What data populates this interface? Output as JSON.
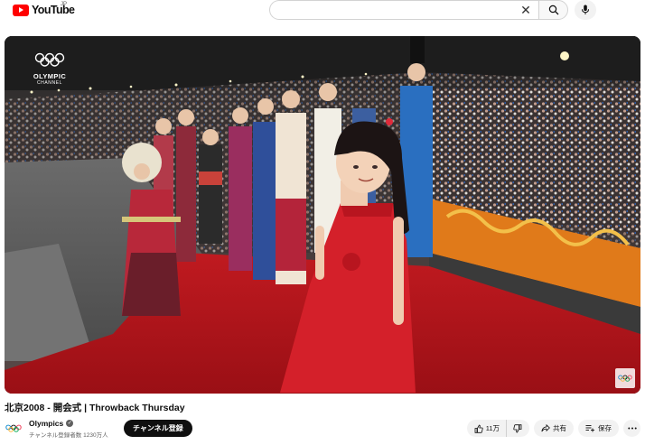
{
  "header": {
    "logo_text": "YouTube",
    "logo_region": "JP",
    "search_value": "",
    "search_icon": "search-icon",
    "clear_icon": "close-icon",
    "mic_icon": "microphone-icon"
  },
  "video": {
    "watermark_line1": "OLYMPIC",
    "watermark_line2": "CHANNEL",
    "colors": {
      "carpet": "#b0131a",
      "dress": "#d4202a",
      "stage": "#5b5b5b",
      "banner": "#e07a1a"
    }
  },
  "title": "北京2008 - 開会式 | Throwback Thursday",
  "channel": {
    "name": "Olympics",
    "subscribers": "チャンネル登録者数 1230万人",
    "subscribe_label": "チャンネル登録",
    "verified_icon": "verified-check-icon"
  },
  "actions": {
    "like_count": "11万",
    "share_label": "共有",
    "save_label": "保存",
    "like_icon": "thumbs-up-icon",
    "dislike_icon": "thumbs-down-icon",
    "share_icon": "share-arrow-icon",
    "save_icon": "playlist-add-icon",
    "more_icon": "more-horizontal-icon"
  }
}
